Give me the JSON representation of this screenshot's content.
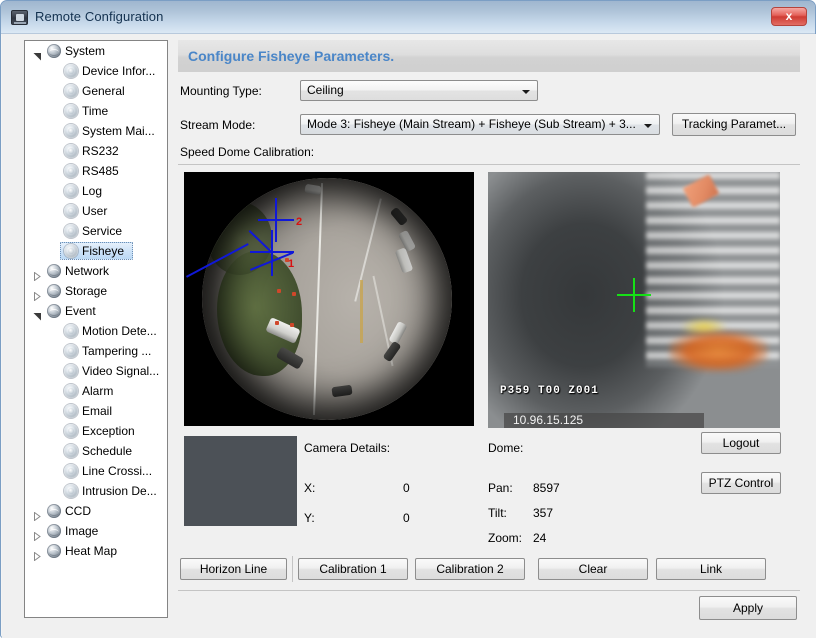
{
  "window": {
    "title": "Remote Configuration",
    "close_label": "x",
    "icon": "camera-icon"
  },
  "sidebar": {
    "nodes": [
      {
        "label": "System",
        "level": 0,
        "expander": "expanded",
        "icon": "globe-icon",
        "selected": false
      },
      {
        "label": "Device Infor...",
        "level": 1,
        "expander": "none",
        "icon": "gear-icon",
        "selected": false
      },
      {
        "label": "General",
        "level": 1,
        "expander": "none",
        "icon": "gear-icon",
        "selected": false
      },
      {
        "label": "Time",
        "level": 1,
        "expander": "none",
        "icon": "gear-icon",
        "selected": false
      },
      {
        "label": "System Mai...",
        "level": 1,
        "expander": "none",
        "icon": "gear-icon",
        "selected": false
      },
      {
        "label": "RS232",
        "level": 1,
        "expander": "none",
        "icon": "gear-icon",
        "selected": false
      },
      {
        "label": "RS485",
        "level": 1,
        "expander": "none",
        "icon": "gear-icon",
        "selected": false
      },
      {
        "label": "Log",
        "level": 1,
        "expander": "none",
        "icon": "gear-icon",
        "selected": false
      },
      {
        "label": "User",
        "level": 1,
        "expander": "none",
        "icon": "gear-icon",
        "selected": false
      },
      {
        "label": "Service",
        "level": 1,
        "expander": "none",
        "icon": "gear-icon",
        "selected": false
      },
      {
        "label": "Fisheye",
        "level": 1,
        "expander": "none",
        "icon": "gear-icon",
        "selected": true
      },
      {
        "label": "Network",
        "level": 0,
        "expander": "collapsed",
        "icon": "globe-icon",
        "selected": false
      },
      {
        "label": "Storage",
        "level": 0,
        "expander": "collapsed",
        "icon": "globe-icon",
        "selected": false
      },
      {
        "label": "Event",
        "level": 0,
        "expander": "expanded",
        "icon": "globe-icon",
        "selected": false
      },
      {
        "label": "Motion Dete...",
        "level": 1,
        "expander": "none",
        "icon": "gear-icon",
        "selected": false
      },
      {
        "label": "Tampering ...",
        "level": 1,
        "expander": "none",
        "icon": "gear-icon",
        "selected": false
      },
      {
        "label": "Video Signal...",
        "level": 1,
        "expander": "none",
        "icon": "gear-icon",
        "selected": false
      },
      {
        "label": "Alarm",
        "level": 1,
        "expander": "none",
        "icon": "gear-icon",
        "selected": false
      },
      {
        "label": "Email",
        "level": 1,
        "expander": "none",
        "icon": "gear-icon",
        "selected": false
      },
      {
        "label": "Exception",
        "level": 1,
        "expander": "none",
        "icon": "gear-icon",
        "selected": false
      },
      {
        "label": "Schedule",
        "level": 1,
        "expander": "none",
        "icon": "gear-icon",
        "selected": false
      },
      {
        "label": "Line Crossi...",
        "level": 1,
        "expander": "none",
        "icon": "gear-icon",
        "selected": false
      },
      {
        "label": "Intrusion De...",
        "level": 1,
        "expander": "none",
        "icon": "gear-icon",
        "selected": false
      },
      {
        "label": "CCD",
        "level": 0,
        "expander": "collapsed",
        "icon": "globe-icon",
        "selected": false
      },
      {
        "label": "Image",
        "level": 0,
        "expander": "collapsed",
        "icon": "globe-icon",
        "selected": false
      },
      {
        "label": "Heat Map",
        "level": 0,
        "expander": "collapsed",
        "icon": "globe-icon",
        "selected": false
      }
    ]
  },
  "page": {
    "banner_title": "Configure Fisheye Parameters.",
    "banner_color": "#4a86c8",
    "mounting_type_label": "Mounting Type:",
    "mounting_type_value": "Ceiling",
    "stream_mode_label": "Stream Mode:",
    "stream_mode_value": "Mode 3: Fisheye (Main Stream) + Fisheye (Sub Stream) + 3...",
    "tracking_parameter_button": "Tracking Paramet...",
    "speed_dome_calibration_label": "Speed Dome Calibration:"
  },
  "preview": {
    "fisheye_calibration_markers": [
      "1",
      "2"
    ],
    "ptz_osd_text": "P359 T00  Z001",
    "ptz_ip_address": "10.96.15.125",
    "crosshair_color": "#16e016",
    "marker_color": "#1018d8",
    "marker_number_color": "#d81010"
  },
  "camera_details": {
    "title": "Camera Details:",
    "x_label": "X:",
    "x_value": "0",
    "y_label": "Y:",
    "y_value": "0"
  },
  "dome": {
    "title": "Dome:",
    "pan_label": "Pan:",
    "pan_value": "8597",
    "tilt_label": "Tilt:",
    "tilt_value": "357",
    "zoom_label": "Zoom:",
    "zoom_value": "24",
    "logout_button": "Logout",
    "ptz_control_button": "PTZ Control"
  },
  "actions": {
    "horizon_line": "Horizon Line",
    "calibration_1": "Calibration 1",
    "calibration_2": "Calibration 2",
    "clear": "Clear",
    "link": "Link",
    "apply": "Apply"
  }
}
